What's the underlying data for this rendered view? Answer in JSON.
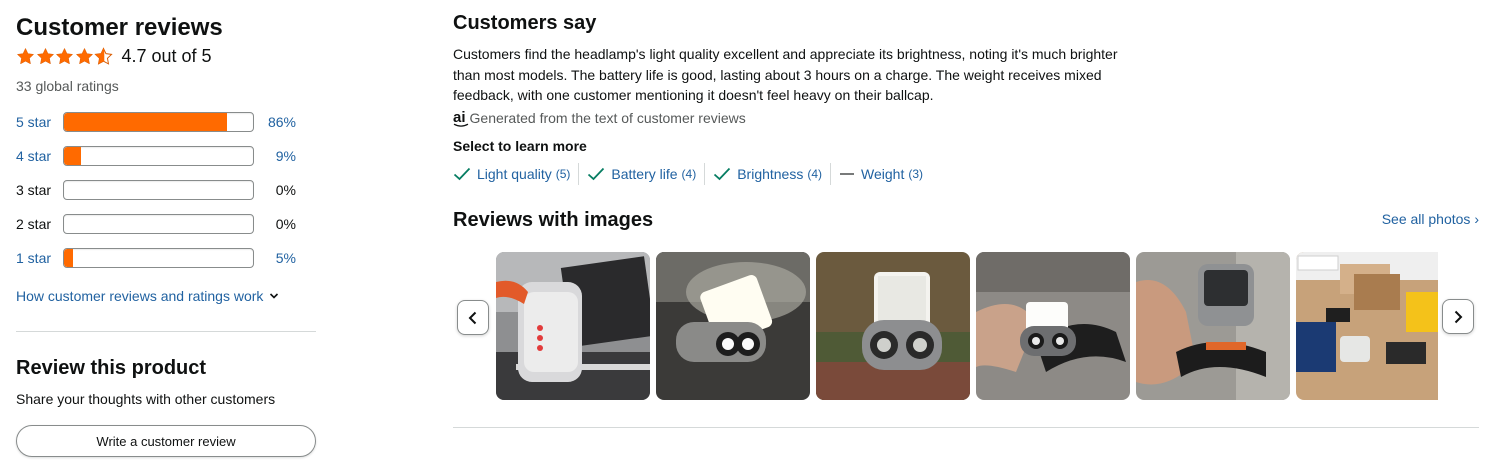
{
  "summary": {
    "title": "Customer reviews",
    "rating": 4.7,
    "avg_text": "4.7 out of 5",
    "global_ratings": "33 global ratings",
    "star_color": "#ff6a00"
  },
  "histogram": [
    {
      "label": "5 star",
      "percent": 86,
      "percent_text": "86%",
      "is_link": true
    },
    {
      "label": "4 star",
      "percent": 9,
      "percent_text": "9%",
      "is_link": true
    },
    {
      "label": "3 star",
      "percent": 0,
      "percent_text": "0%",
      "is_link": false
    },
    {
      "label": "2 star",
      "percent": 0,
      "percent_text": "0%",
      "is_link": false
    },
    {
      "label": "1 star",
      "percent": 5,
      "percent_text": "5%",
      "is_link": true
    }
  ],
  "how_link": "How customer reviews and ratings work",
  "review_product": {
    "title": "Review this product",
    "subtitle": "Share your thoughts with other customers",
    "button_label": "Write a customer review"
  },
  "customers_say": {
    "title": "Customers say",
    "body": "Customers find the headlamp's light quality excellent and appreciate its brightness, noting it's much brighter than most models. The battery life is good, lasting about 3 hours on a charge. The weight receives mixed feedback, with one customer mentioning it doesn't feel heavy on their ballcap.",
    "ai_icon_text": "ai",
    "ai_note": "Generated from the text of customer reviews",
    "select_label": "Select to learn more",
    "aspects": [
      {
        "label": "Light quality",
        "count": "(5)",
        "sentiment": "positive",
        "icon": "check-icon"
      },
      {
        "label": "Battery life",
        "count": "(4)",
        "sentiment": "positive",
        "icon": "check-icon"
      },
      {
        "label": "Brightness",
        "count": "(4)",
        "sentiment": "positive",
        "icon": "check-icon"
      },
      {
        "label": "Weight",
        "count": "(3)",
        "sentiment": "mixed",
        "icon": "dash-icon"
      }
    ]
  },
  "reviews_with_images": {
    "title": "Reviews with images",
    "see_all": "See all photos",
    "thumb_count": 6
  },
  "colors": {
    "link": "#2162a1",
    "accent": "#ff6a00",
    "positive": "#067d62"
  }
}
